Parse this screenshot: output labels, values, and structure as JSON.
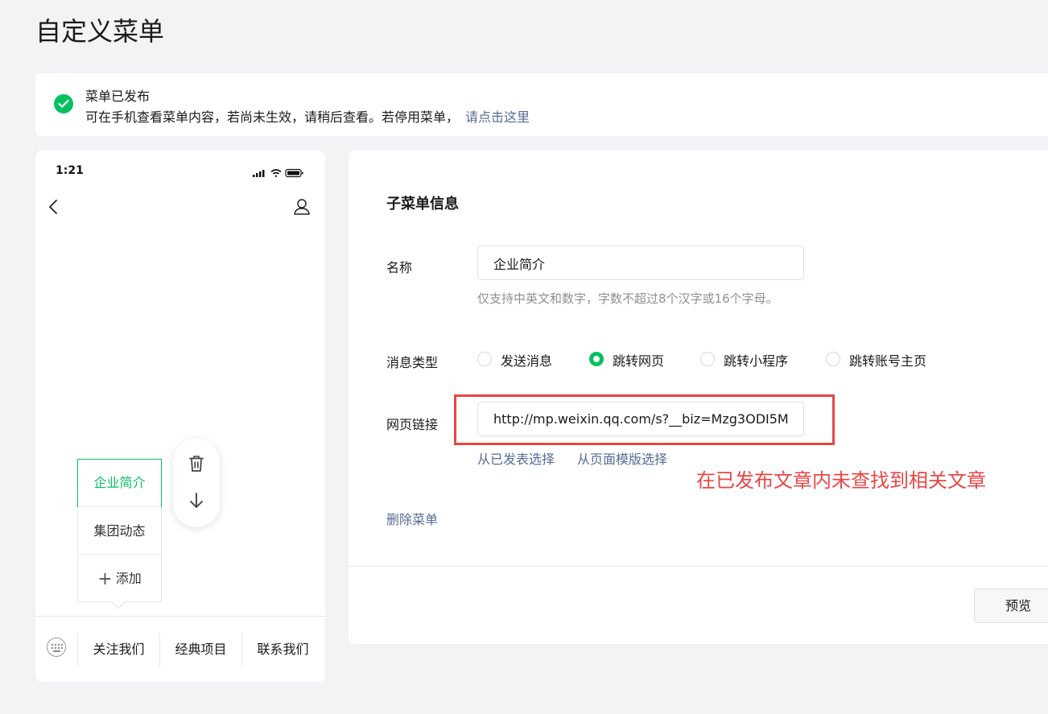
{
  "page": {
    "title": "自定义菜单"
  },
  "notice": {
    "title": "菜单已发布",
    "desc": "可在手机查看菜单内容，若尚未生效，请稍后查看。若停用菜单，",
    "link": "请点击这里"
  },
  "phone": {
    "status_time": "1:21",
    "sub_menu": [
      {
        "label": "企业简介",
        "active": true
      },
      {
        "label": "集团动态",
        "active": false
      }
    ],
    "add_label": "添加",
    "add_icon": "plus-icon",
    "main_menu": [
      "关注我们",
      "经典项目",
      "联系我们"
    ]
  },
  "form": {
    "section_title": "子菜单信息",
    "name_label": "名称",
    "name_value": "企业简介",
    "name_hint": "仅支持中英文和数字，字数不超过8个汉字或16个字母。",
    "type_label": "消息类型",
    "types": [
      {
        "label": "发送消息",
        "checked": false
      },
      {
        "label": "跳转网页",
        "checked": true
      },
      {
        "label": "跳转小程序",
        "checked": false
      },
      {
        "label": "跳转账号主页",
        "checked": false
      }
    ],
    "url_label": "网页链接",
    "url_value": "http://mp.weixin.qq.com/s?__biz=Mzg3ODI5M",
    "pick_published": "从已发表选择",
    "pick_template": "从页面模版选择",
    "error_annotation": "在已发布文章内未查找到相关文章",
    "delete_label": "删除菜单",
    "preview_label": "预览"
  },
  "colors": {
    "accent": "#07c160",
    "link": "#576b95",
    "error": "#e94545"
  }
}
